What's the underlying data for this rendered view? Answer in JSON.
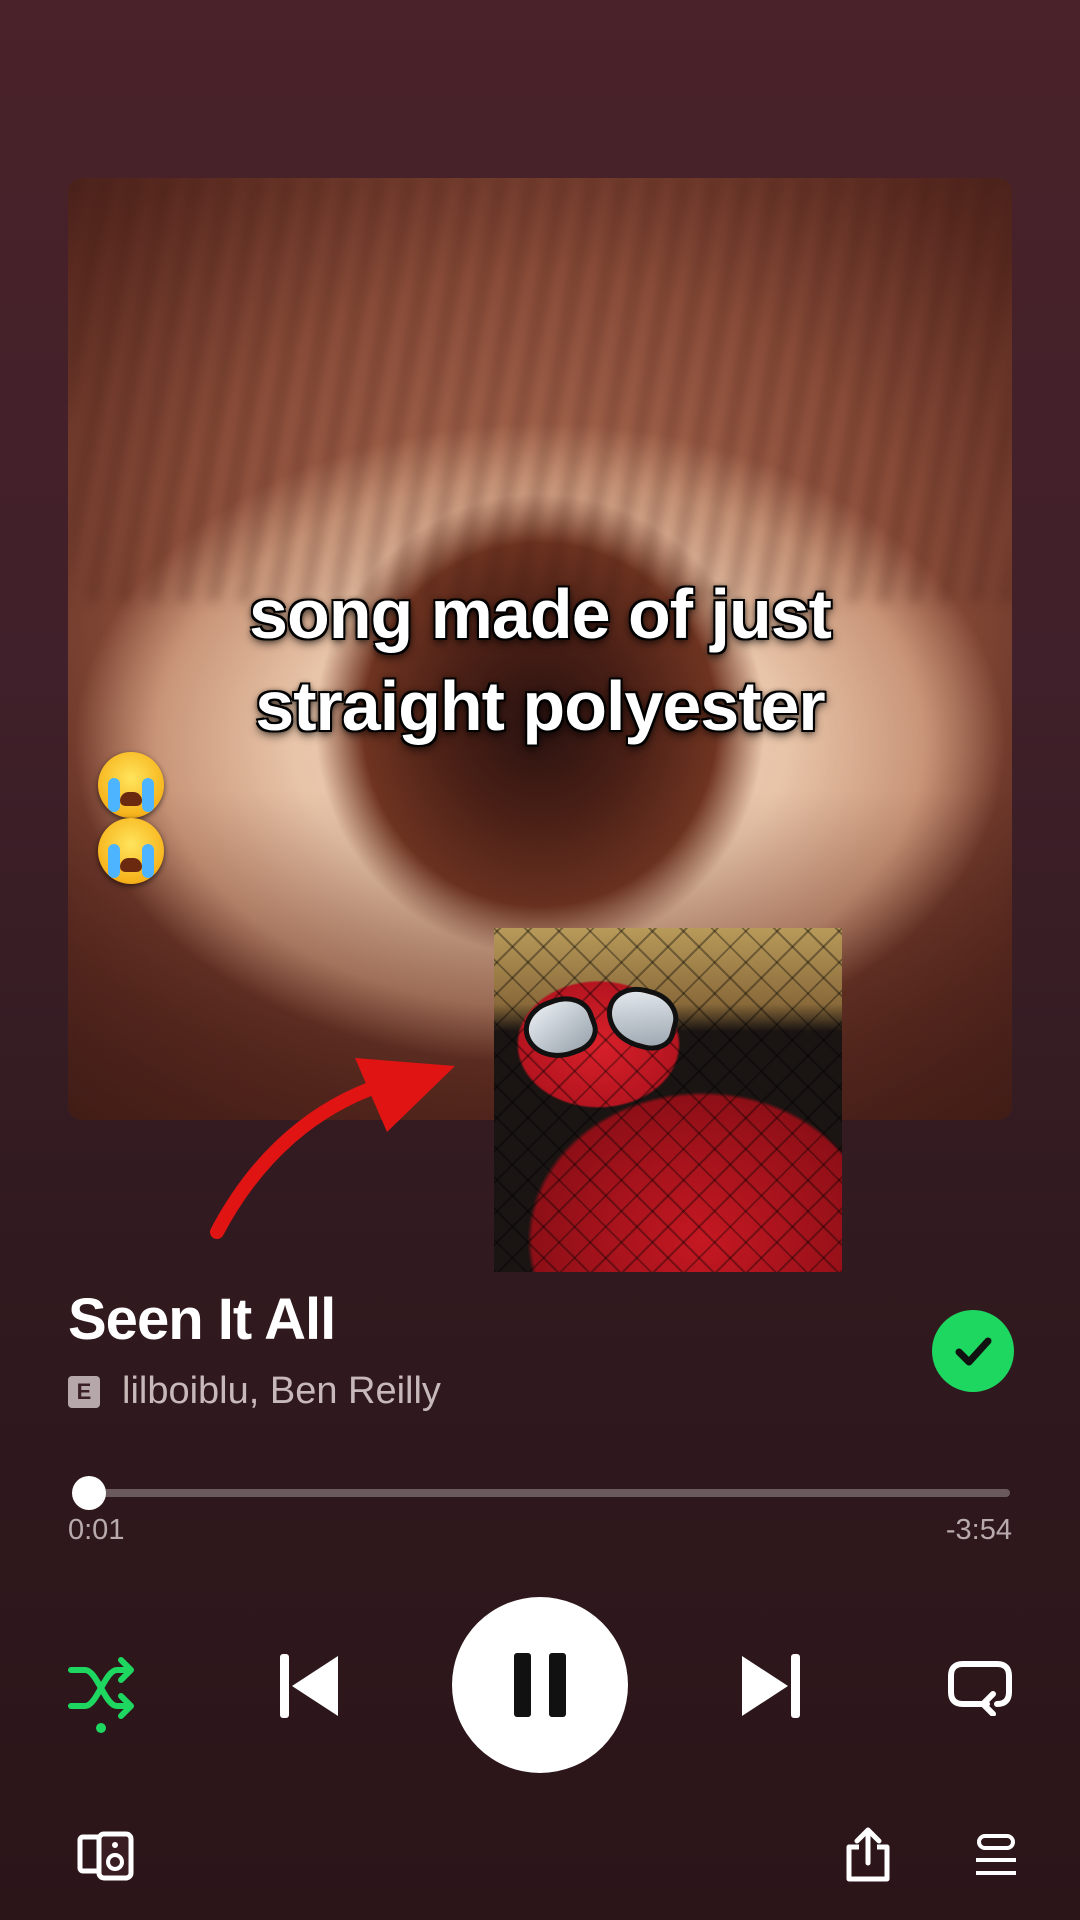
{
  "overlay": {
    "caption_line1": "song made of just",
    "caption_line2": "straight polyester",
    "caption_emoji": [
      "loudly-crying-face",
      "loudly-crying-face"
    ]
  },
  "track": {
    "title": "Seen It All",
    "explicit_label": "E",
    "artists": "lilboiblu, Ben Reilly",
    "liked": true
  },
  "playback": {
    "elapsed": "0:01",
    "remaining": "-3:54",
    "progress_fraction": 0.004,
    "is_playing": true,
    "shuffle_on": true
  },
  "colors": {
    "accent": "#1ed760",
    "background_top": "#4a2229",
    "background_bottom": "#2b1519"
  },
  "icons": {
    "shuffle": "shuffle-icon",
    "previous": "skip-previous-icon",
    "pause": "pause-icon",
    "next": "skip-next-icon",
    "repeat": "repeat-icon",
    "devices": "connect-devices-icon",
    "share": "share-icon",
    "queue": "queue-icon",
    "liked": "check-icon"
  }
}
